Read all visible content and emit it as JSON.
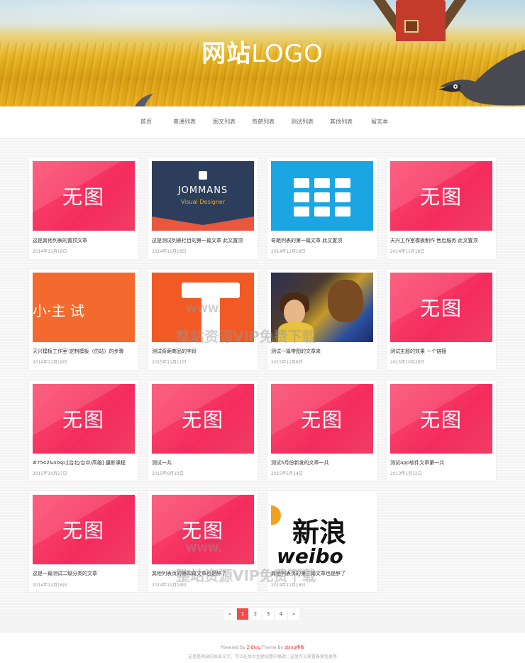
{
  "header": {
    "logo_cn": "网站",
    "logo_en": "LOGO"
  },
  "nav": {
    "items": [
      "首页",
      "普通列表",
      "图文列表",
      "奇葩列表",
      "测试列表",
      "其他列表",
      "留言本"
    ]
  },
  "posts": [
    {
      "thumb": "无图",
      "title": "这是其他列表的置顶文章",
      "date": "2014年11月18日"
    },
    {
      "thumb_brand": "JOMMANS",
      "thumb_sub": "Visual Designer",
      "title": "这是测试列表栏目的第一篇文章 此文置顶",
      "date": "2014年11月18日"
    },
    {
      "title": "奇葩列表的第一篇文章 此文置顶",
      "date": "2014年11月18日"
    },
    {
      "thumb": "无图",
      "title": "天兴工作室模板制作 售后服务 此文置顶",
      "date": "2014年11月18日"
    },
    {
      "thumb_text": "小·主    试",
      "title": "天兴模板工作室-定制模板（仿站）的步骤",
      "date": "2014年11月18日"
    },
    {
      "title": "测试奇葩商品的字段",
      "date": "2015年11月11日"
    },
    {
      "title": "测试一篇带图的文章来",
      "date": "2015年11月8日"
    },
    {
      "thumb": "无图",
      "title": "测试主题的效果 一个链接",
      "date": "2015年10月28日"
    },
    {
      "thumb": "无图",
      "title": "#7542&nbsp;[台北/台中/高雄] 摄影课程",
      "date": "2015年10月27日"
    },
    {
      "thumb": "无图",
      "title": "测试一共",
      "date": "2015年6月10日"
    },
    {
      "thumb": "无图",
      "title": "测试5月份新发的文章一共",
      "date": "2015年5月14日"
    },
    {
      "thumb": "无图",
      "title": "测试app软件文章第一共",
      "date": "2013年1月12日"
    },
    {
      "thumb": "无图",
      "title": "这是一篇测试二级分类的文章",
      "date": "2014年12月16日"
    },
    {
      "thumb": "无图",
      "title": "其他列表页的第四篇文章也是醉了",
      "date": "2014年11月18日"
    },
    {
      "thumb_cn": "新浪",
      "thumb_en": "weibo",
      "title": "其他列表页的第三篇文章也是醉了",
      "date": "2014年11月18日"
    }
  ],
  "pagination": {
    "prev": "«",
    "pages": [
      "1",
      "2",
      "3",
      "4"
    ],
    "current": "1",
    "next": "»"
  },
  "footer": {
    "powered_prefix": "Powered By ",
    "zblog": "Z-Blog",
    "theme_mid": ",Theme By ",
    "theme_author": "zblog模板",
    "notice": "这里是网站的底部文字，可以在后台主题设置中修改，这里可以放置备案信息等"
  },
  "watermark": {
    "url": "WWW.",
    "text": "整站资源VIP免费下载"
  },
  "colors": {
    "noimg": "#f42c5d",
    "page_current": "#f14b4b",
    "footer_link": "#e33"
  }
}
